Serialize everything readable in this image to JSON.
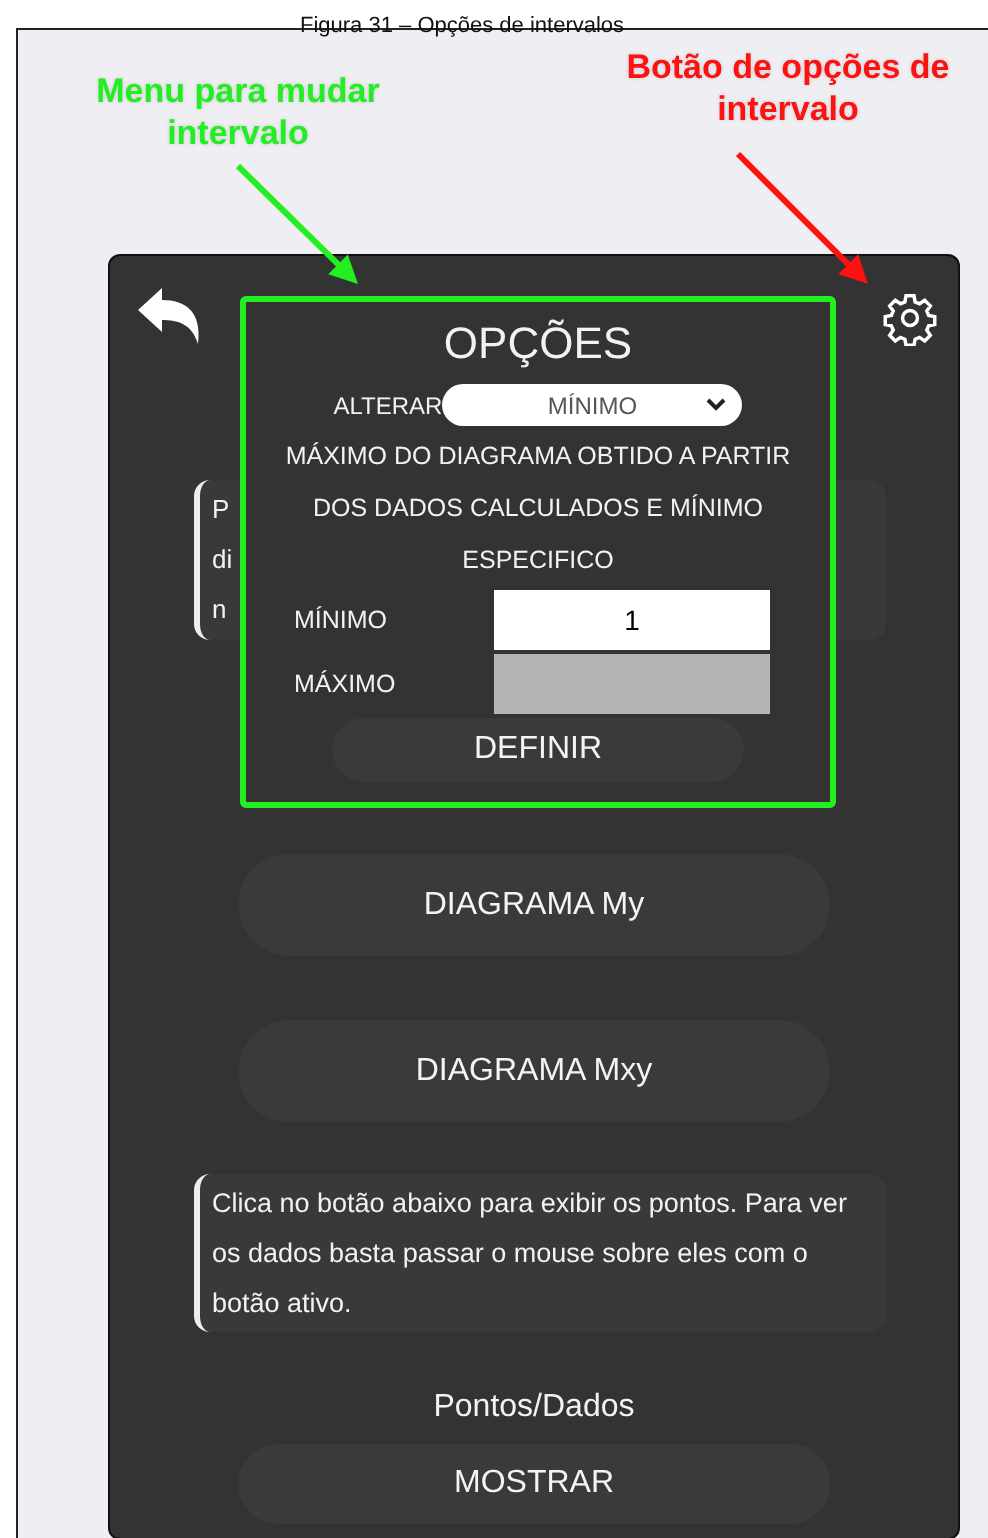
{
  "caption": "Figura 31 – Opções de intervalos",
  "annotations": [
    {
      "text": "Menu para mudar intervalo",
      "color": "#22ee22"
    },
    {
      "text": "Botão de opções de intervalo",
      "color": "#ff1111"
    }
  ],
  "app": {
    "note_behind": [
      "P",
      "di",
      "n"
    ],
    "options": {
      "title": "OPÇÕES",
      "change_label": "ALTERAR",
      "change_value": "MÍNIMO",
      "description": "MÁXIMO DO DIAGRAMA OBTIDO A PARTIR DOS DADOS CALCULADOS E MÍNIMO ESPECIFICO",
      "fields": [
        {
          "label": "MÍNIMO",
          "value": "1",
          "disabled": false
        },
        {
          "label": "MÁXIMO",
          "disabled": true
        }
      ],
      "button": "DEFINIR"
    },
    "buttons": [
      "DIAGRAMA My",
      "DIAGRAMA Mxy"
    ],
    "note": "Clica no botão abaixo para exibir os pontos. Para ver os dados basta passar o mouse sobre eles com o botão ativo.",
    "points_label": "Pontos/Dados",
    "points_button": "MOSTRAR"
  }
}
